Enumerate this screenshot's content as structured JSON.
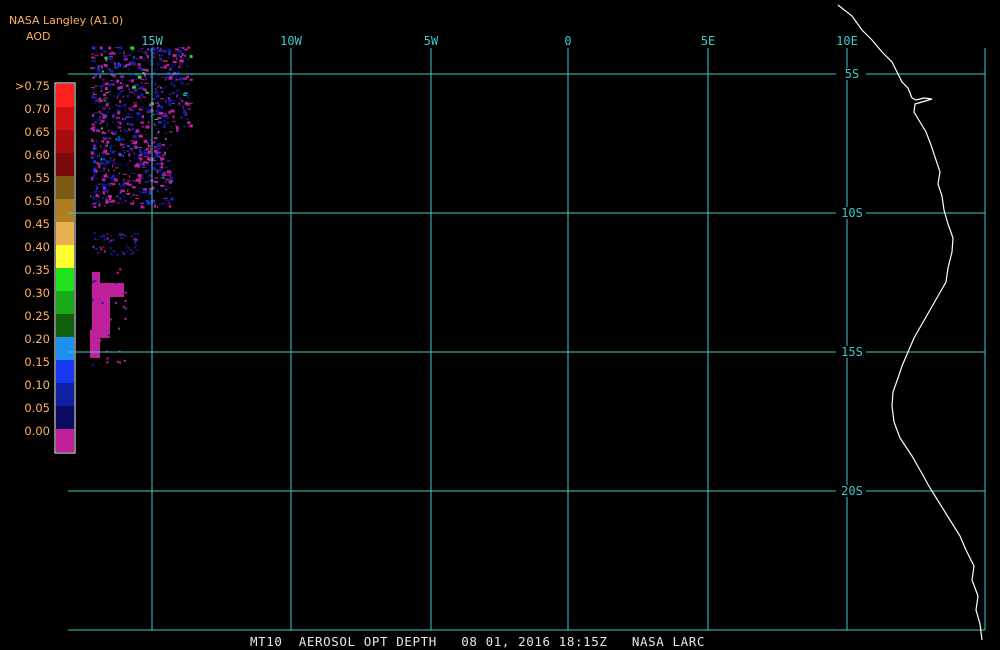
{
  "header": {
    "title": "NASA Langley (A1.0)",
    "variable": "AOD"
  },
  "legend": {
    "labels": [
      ">0.75",
      "0.70",
      "0.65",
      "0.60",
      "0.55",
      "0.50",
      "0.45",
      "0.40",
      "0.35",
      "0.30",
      "0.25",
      "0.20",
      "0.15",
      "0.10",
      "0.05",
      "0.00"
    ],
    "colors": [
      "#ff2020",
      "#d01010",
      "#a80c0c",
      "#7a0a0a",
      "#7a5a10",
      "#b08020",
      "#e8b050",
      "#ffff30",
      "#20e020",
      "#18a818",
      "#106010",
      "#2090f0",
      "#1838f0",
      "#1020a0",
      "#0a0a60",
      "#c0209a"
    ],
    "label_color": "#ffb060"
  },
  "map": {
    "lon_labels": [
      "15W",
      "10W",
      "5W",
      "0",
      "5E",
      "10E"
    ],
    "lat_labels": [
      "5S",
      "10S",
      "15S",
      "20S"
    ],
    "grid_color": "#40c8c8",
    "coast_color": "#ffffff",
    "no_data_color": "#000000"
  },
  "footer": {
    "text": "MT10  AEROSOL OPT DEPTH   08 01, 2016 18:15Z   NASA LARC"
  }
}
